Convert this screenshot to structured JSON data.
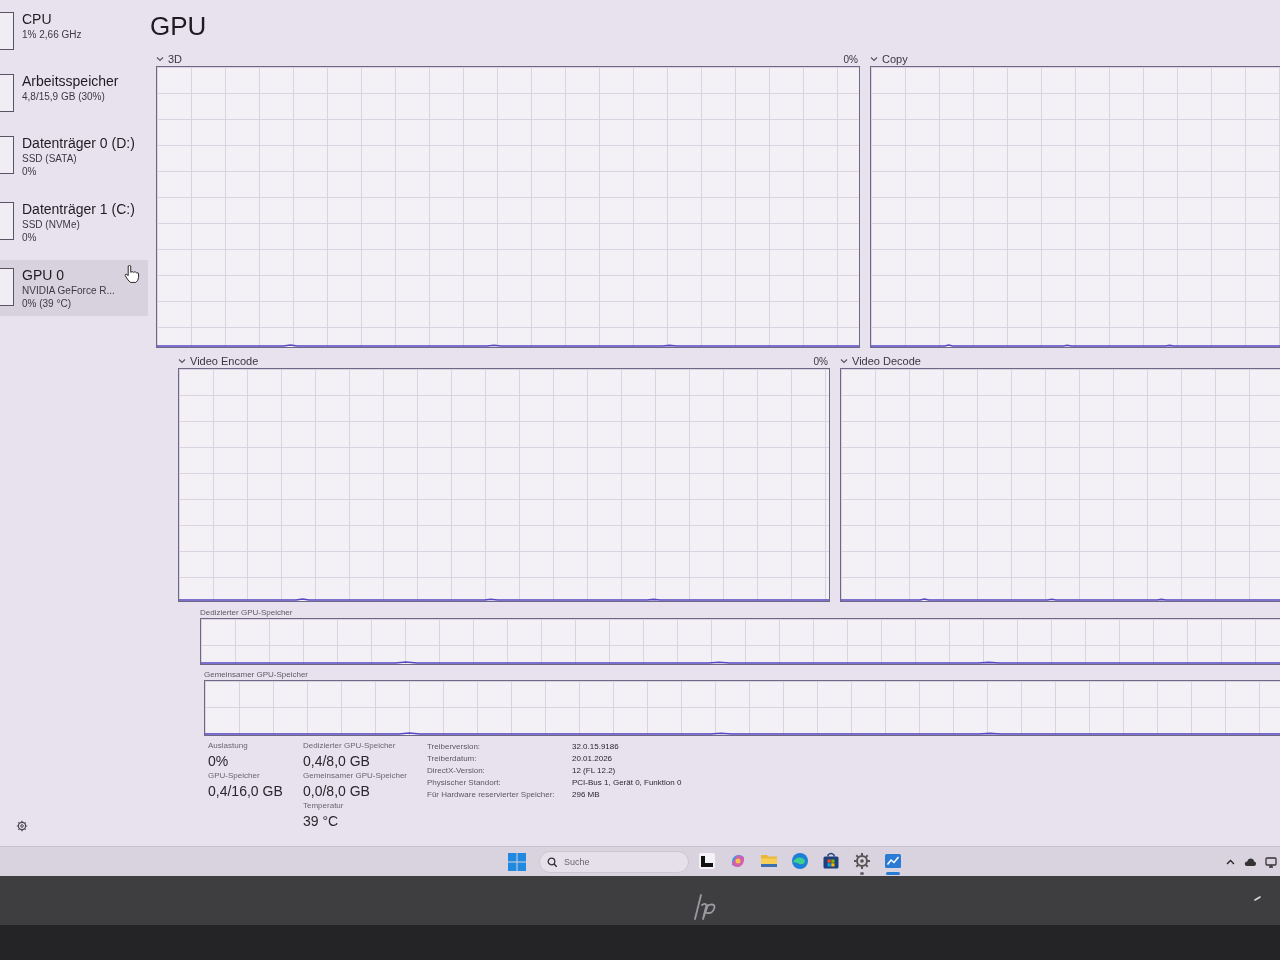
{
  "sidebar": {
    "items": [
      {
        "title": "CPU",
        "details": [
          "1% 2,66 GHz"
        ],
        "selected": false
      },
      {
        "title": "Arbeitsspeicher",
        "details": [
          "4,8/15,9 GB (30%)"
        ],
        "selected": false
      },
      {
        "title": "Datenträger 0 (D:)",
        "details": [
          "SSD (SATA)",
          "0%"
        ],
        "selected": false
      },
      {
        "title": "Datenträger 1 (C:)",
        "details": [
          "SSD (NVMe)",
          "0%"
        ],
        "selected": false
      },
      {
        "title": "GPU 0",
        "details": [
          "NVIDIA GeForce R...",
          "0% (39 °C)"
        ],
        "selected": true
      }
    ]
  },
  "page": {
    "title": "GPU"
  },
  "engine_graphs": [
    {
      "label": "3D",
      "reading": "0%"
    },
    {
      "label": "Copy"
    },
    {
      "label": "Video Encode",
      "reading": "0%"
    },
    {
      "label": "Video Decode"
    }
  ],
  "memory_graphs": [
    {
      "label": "Dedizierter GPU-Speicher"
    },
    {
      "label": "Gemeinsamer GPU-Speicher"
    }
  ],
  "stat_columns": [
    {
      "items": [
        {
          "label": "Auslastung",
          "value": "0%"
        },
        {
          "label": "GPU-Speicher",
          "value": "0,4/16,0 GB"
        }
      ]
    },
    {
      "items": [
        {
          "label": "Dedizierter GPU-Speicher",
          "value": "0,4/8,0 GB"
        },
        {
          "label": "Gemeinsamer GPU-Speicher",
          "value": "0,0/8,0 GB"
        },
        {
          "label": "Temperatur",
          "value": "39 °C"
        }
      ]
    }
  ],
  "details": [
    {
      "label": "Treiberversion:",
      "value": "32.0.15.9186"
    },
    {
      "label": "Treiberdatum:",
      "value": "20.01.2026"
    },
    {
      "label": "DirectX-Version:",
      "value": "12 (FL 12.2)"
    },
    {
      "label": "Physischer Standort:",
      "value": "PCI-Bus 1, Gerät 0, Funktion 0"
    },
    {
      "label": "Für Hardware reservierter Speicher:",
      "value": "296 MB"
    }
  ],
  "taskbar": {
    "search": {
      "placeholder": "Suche"
    },
    "apps": [
      {
        "running": false,
        "selected": false
      },
      {
        "running": false,
        "selected": false
      },
      {
        "running": false,
        "selected": false
      },
      {
        "running": false,
        "selected": false
      },
      {
        "running": false,
        "selected": false
      },
      {
        "running": true,
        "selected": false
      },
      {
        "running": true,
        "selected": true
      }
    ]
  }
}
